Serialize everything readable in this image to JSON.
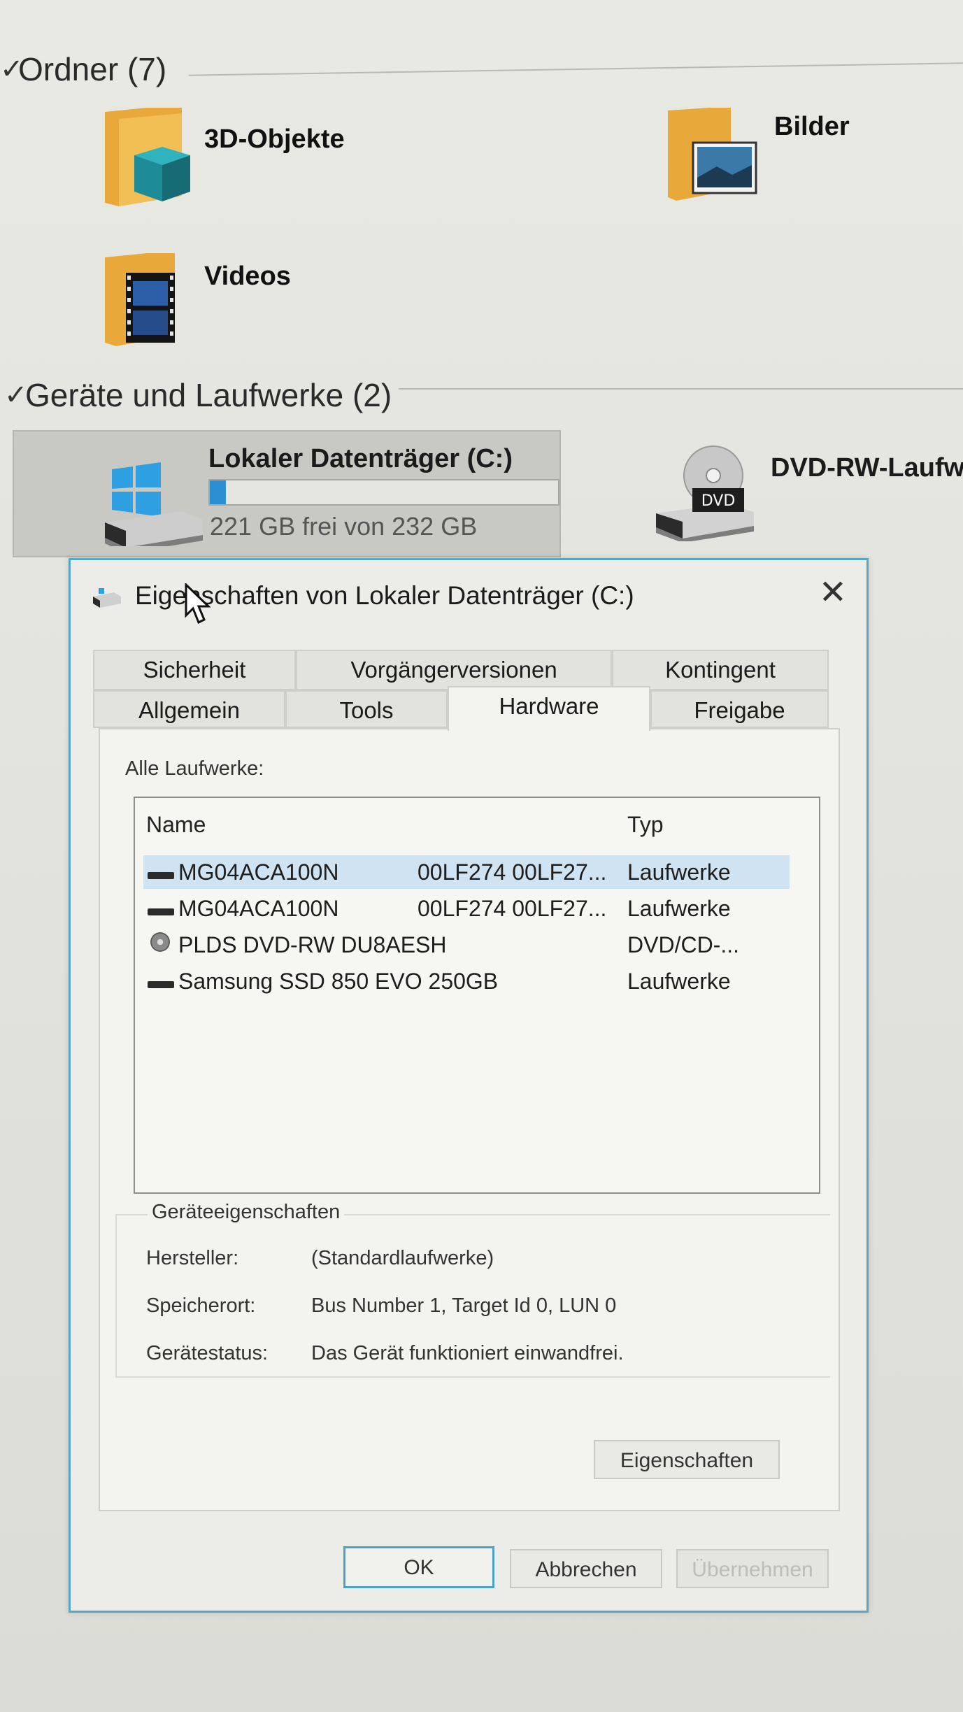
{
  "folders_group": {
    "label": "Ordner (7)",
    "items": [
      {
        "name": "3D-Objekte",
        "icon": "folder-3d-objects-icon"
      },
      {
        "name": "Bilder",
        "icon": "folder-pictures-icon"
      },
      {
        "name": "Videos",
        "icon": "folder-videos-icon"
      }
    ]
  },
  "devices_group": {
    "label": "Geräte und Laufwerke (2)",
    "drive_c": {
      "name": "Lokaler Datenträger (C:)",
      "free_text": "221 GB frei von 232 GB",
      "used_fraction": 0.047,
      "icon": "windows-drive-icon"
    },
    "drive_dvd": {
      "name": "DVD-RW-Laufw",
      "icon_label": "DVD",
      "icon": "dvd-drive-icon"
    }
  },
  "dialog": {
    "title": "Eigenschaften von Lokaler Datenträger (C:)",
    "close": "✕",
    "tabs_row1": [
      "Sicherheit",
      "Vorgängerversionen",
      "Kontingent"
    ],
    "tabs_row2": [
      "Allgemein",
      "Tools",
      "Hardware",
      "Freigabe"
    ],
    "active_tab": "Hardware",
    "all_drives_label": "Alle Laufwerke:",
    "columns": {
      "name": "Name",
      "type": "Typ"
    },
    "drives": [
      {
        "name": "MG04ACA100N",
        "id": "00LF274 00LF27...",
        "type": "Laufwerke",
        "icon": "hdd-icon",
        "selected": true
      },
      {
        "name": "MG04ACA100N",
        "id": "00LF274 00LF27...",
        "type": "Laufwerke",
        "icon": "hdd-icon",
        "selected": false
      },
      {
        "name": "PLDS DVD-RW DU8AESH",
        "id": "",
        "type": "DVD/CD-...",
        "icon": "dvd-icon",
        "selected": false
      },
      {
        "name": "Samsung SSD 850 EVO 250GB",
        "id": "",
        "type": "Laufwerke",
        "icon": "hdd-icon",
        "selected": false
      }
    ],
    "props": {
      "heading": "Geräteeigenschaften",
      "manufacturer_label": "Hersteller:",
      "manufacturer": "(Standardlaufwerke)",
      "location_label": "Speicherort:",
      "location": "Bus Number 1, Target Id 0, LUN 0",
      "status_label": "Gerätestatus:",
      "status": "Das Gerät funktioniert einwandfrei."
    },
    "properties_button": "Eigenschaften",
    "ok": "OK",
    "cancel": "Abbrechen",
    "apply": "Übernehmen"
  }
}
